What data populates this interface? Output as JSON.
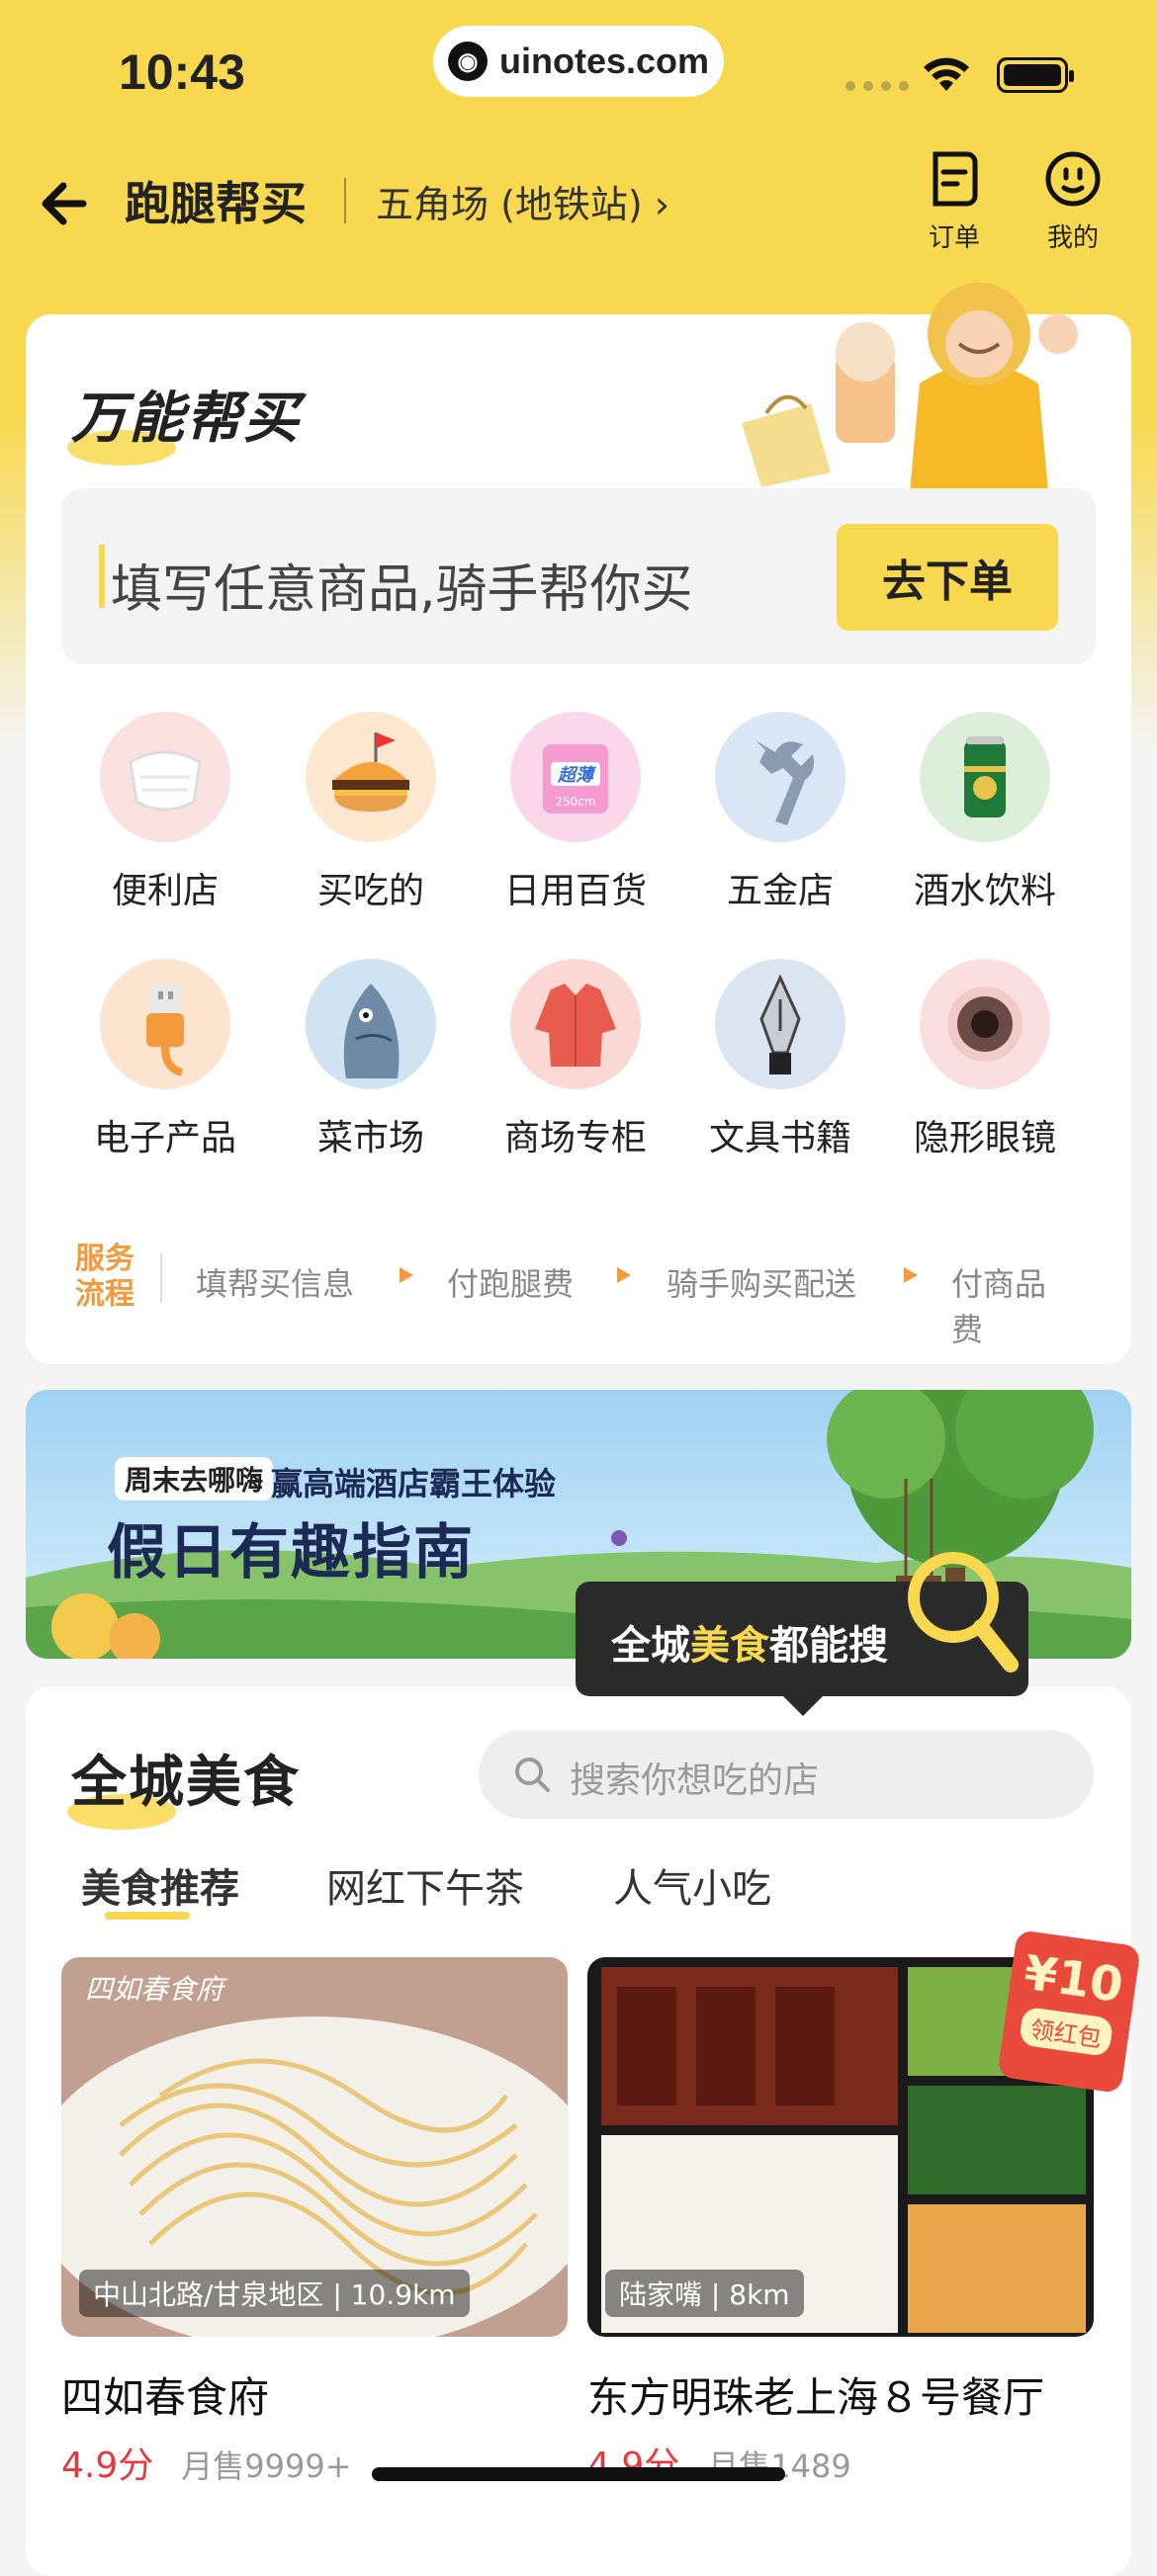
{
  "status_bar": {
    "time": "10:43",
    "url": "uinotes.com"
  },
  "nav": {
    "title": "跑腿帮买",
    "location": "五角场 (地铁站)",
    "orders_label": "订单",
    "mine_label": "我的"
  },
  "buy_section": {
    "title": "万能帮买",
    "placeholder": "填写任意商品,骑手帮你买",
    "order_button": "去下单",
    "categories": [
      {
        "label": "便利店",
        "icon": "mask-icon"
      },
      {
        "label": "买吃的",
        "icon": "burger-icon"
      },
      {
        "label": "日用百货",
        "icon": "tissue-pack-icon"
      },
      {
        "label": "五金店",
        "icon": "wrench-icon"
      },
      {
        "label": "酒水饮料",
        "icon": "beer-can-icon"
      },
      {
        "label": "电子产品",
        "icon": "usb-cable-icon"
      },
      {
        "label": "菜市场",
        "icon": "fish-icon"
      },
      {
        "label": "商场专柜",
        "icon": "shirt-icon"
      },
      {
        "label": "文具书籍",
        "icon": "fountain-pen-icon"
      },
      {
        "label": "隐形眼镜",
        "icon": "contact-lens-icon"
      }
    ],
    "tissue_text": "超薄",
    "tissue_size": "250cm",
    "flow": {
      "tag": "服务流程",
      "steps": [
        "填帮买信息",
        "付跑腿费",
        "骑手购买配送",
        "付商品费"
      ]
    }
  },
  "banner": {
    "tag": "周末去哪嗨",
    "subtitle": "赢高端酒店霸王体验",
    "title": "假日有趣指南"
  },
  "tooltip": {
    "prefix": "全城",
    "highlight": "美食",
    "suffix": "都能搜"
  },
  "food_section": {
    "title": "全城美食",
    "search_placeholder": "搜索你想吃的店",
    "tabs": [
      "美食推荐",
      "网红下午茶",
      "人气小吃"
    ],
    "shops": [
      {
        "name": "四如春食府",
        "location": "中山北路/甘泉地区",
        "distance": "10.9km",
        "score": "4.9分",
        "sales": "月售9999+",
        "sign": "四如春食府"
      },
      {
        "name": "东方明珠老上海８号餐厅",
        "location": "陆家嘴",
        "distance": "8km",
        "score": "4.9分",
        "sales": "月售1489"
      }
    ],
    "red_packet": {
      "amount": "¥10",
      "label": "领红包"
    }
  },
  "colors": {
    "brand_yellow": "#f8d84f",
    "price_red": "#e8383d",
    "flow_orange": "#f29a3c"
  }
}
